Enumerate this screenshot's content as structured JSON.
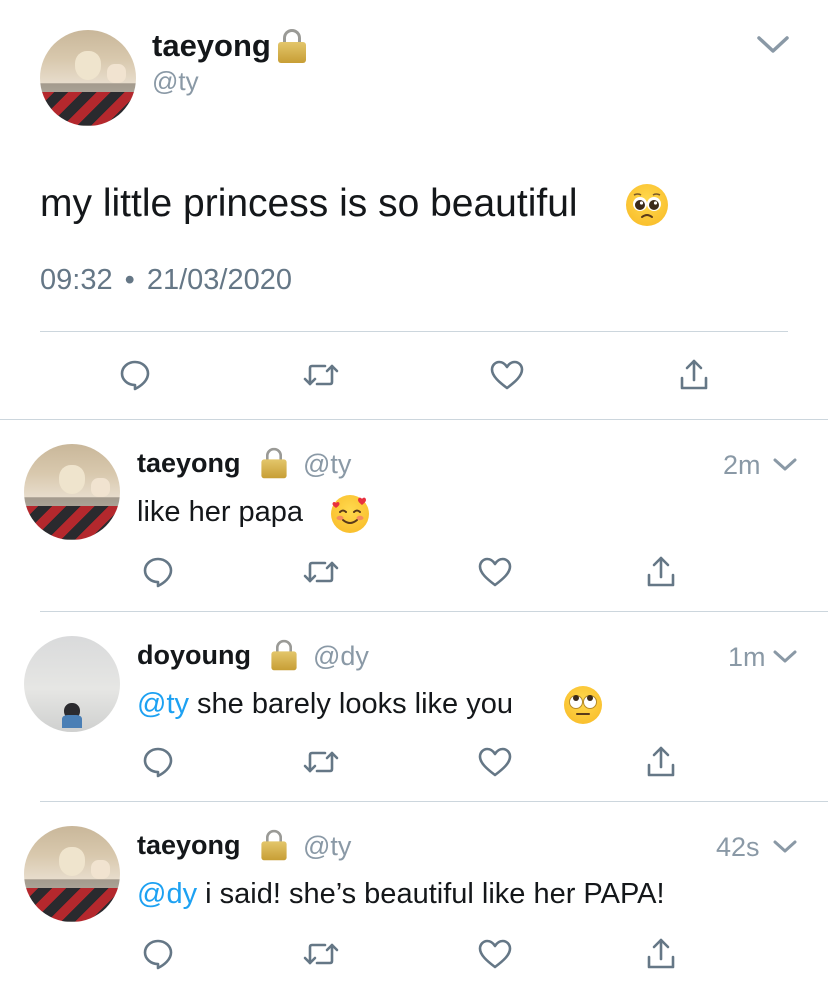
{
  "main_tweet": {
    "author_name": "taeyong",
    "author_handle": "@ty",
    "text": "my little princess is so beautiful",
    "time": "09:32",
    "separator": "•",
    "date": "21/03/2020"
  },
  "replies": [
    {
      "author_name": "taeyong",
      "author_handle": "@ty",
      "time_ago": "2m",
      "mention": "",
      "text": "like her papa"
    },
    {
      "author_name": "doyoung",
      "author_handle": "@dy",
      "time_ago": "1m",
      "mention": "@ty",
      "text": " she barely looks like you"
    },
    {
      "author_name": "taeyong",
      "author_handle": "@ty",
      "time_ago": "42s",
      "mention": "@dy",
      "text": " i said! she’s beautiful like her PAPA!"
    }
  ],
  "icons": {
    "reply": "speech-bubble-icon",
    "retweet": "retweet-icon",
    "like": "heart-icon",
    "share": "share-upload-icon",
    "lock": "lock-icon",
    "menu": "chevron-down-icon"
  },
  "colors": {
    "accent": "#1da1f2",
    "muted": "#8a99a6",
    "text": "#14171a",
    "icon": "#657786"
  }
}
